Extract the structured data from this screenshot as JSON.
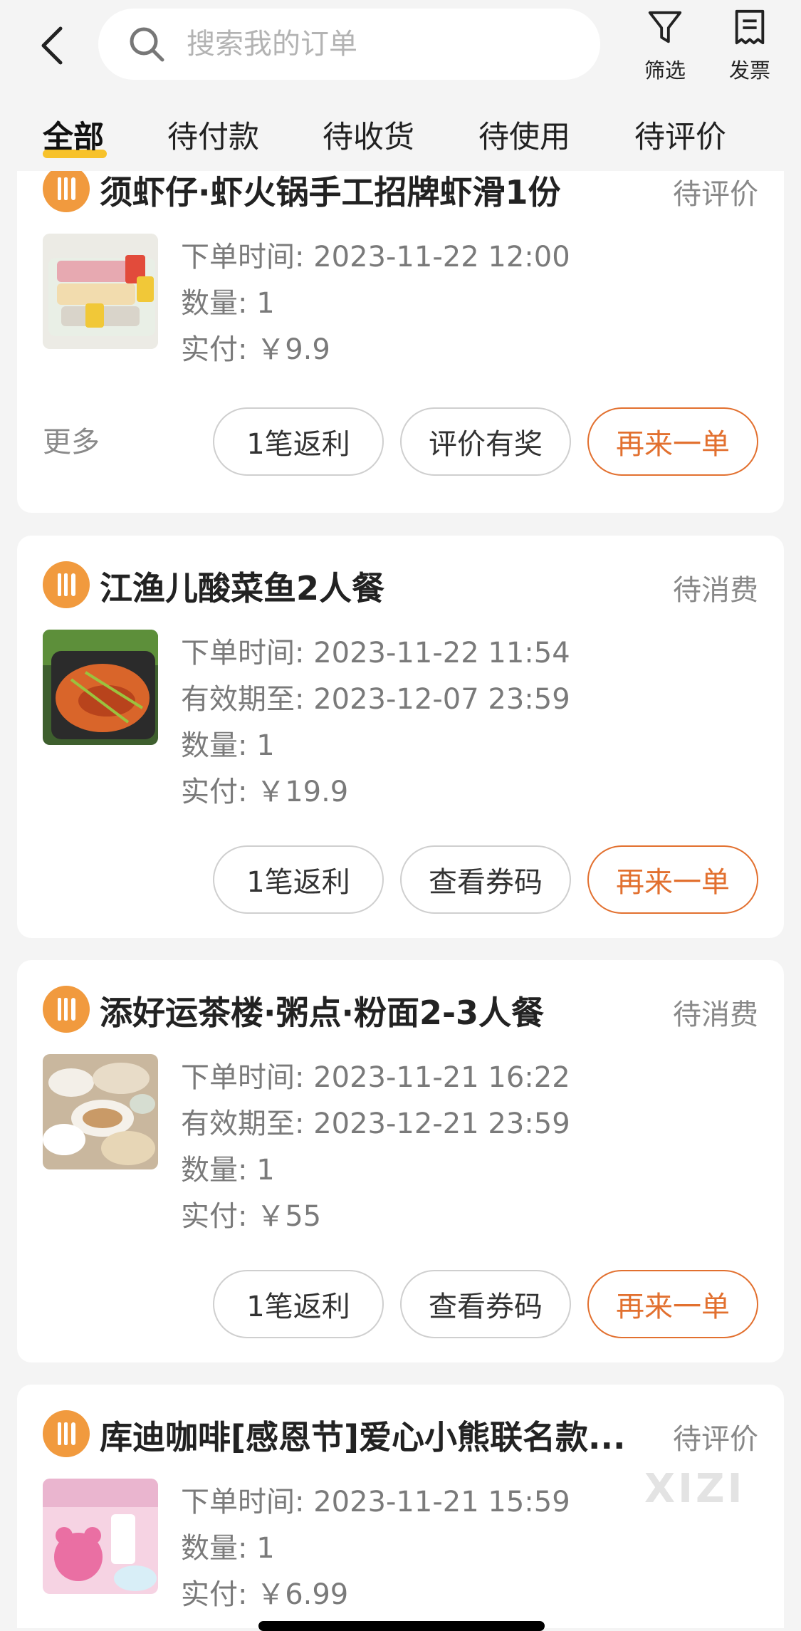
{
  "header": {
    "search_placeholder": "搜索我的订单",
    "filter_label": "筛选",
    "invoice_label": "发票"
  },
  "tabs": [
    "全部",
    "待付款",
    "待收货",
    "待使用",
    "待评价"
  ],
  "orders": [
    {
      "title": "须虾仔·虾火锅手工招牌虾滑1份",
      "status": "待评价",
      "order_time": "下单时间: 2023-11-22 12:00",
      "quantity": "数量: 1",
      "paid": "实付: ￥9.9",
      "more": "更多",
      "buttons": [
        "1笔返利",
        "评价有奖",
        "再来一单"
      ]
    },
    {
      "title": "江渔儿酸菜鱼2人餐",
      "status": "待消费",
      "order_time": "下单时间: 2023-11-22 11:54",
      "valid_until": "有效期至: 2023-12-07 23:59",
      "quantity": "数量: 1",
      "paid": "实付: ￥19.9",
      "buttons": [
        "1笔返利",
        "查看券码",
        "再来一单"
      ]
    },
    {
      "title": "添好运茶楼·粥点·粉面2-3人餐",
      "status": "待消费",
      "order_time": "下单时间: 2023-11-21 16:22",
      "valid_until": "有效期至: 2023-12-21 23:59",
      "quantity": "数量: 1",
      "paid": "实付: ￥55",
      "buttons": [
        "1笔返利",
        "查看券码",
        "再来一单"
      ]
    },
    {
      "title": "库迪咖啡[感恩节]爱心小熊联名款...",
      "status": "待评价",
      "order_time": "下单时间: 2023-11-21 15:59",
      "quantity": "数量: 1",
      "paid": "实付: ￥6.99"
    }
  ],
  "watermark": "XIZI",
  "colors": {
    "accent": "#e2702f",
    "badge": "#f19a3e",
    "tab_underline": "#f7c22b"
  }
}
